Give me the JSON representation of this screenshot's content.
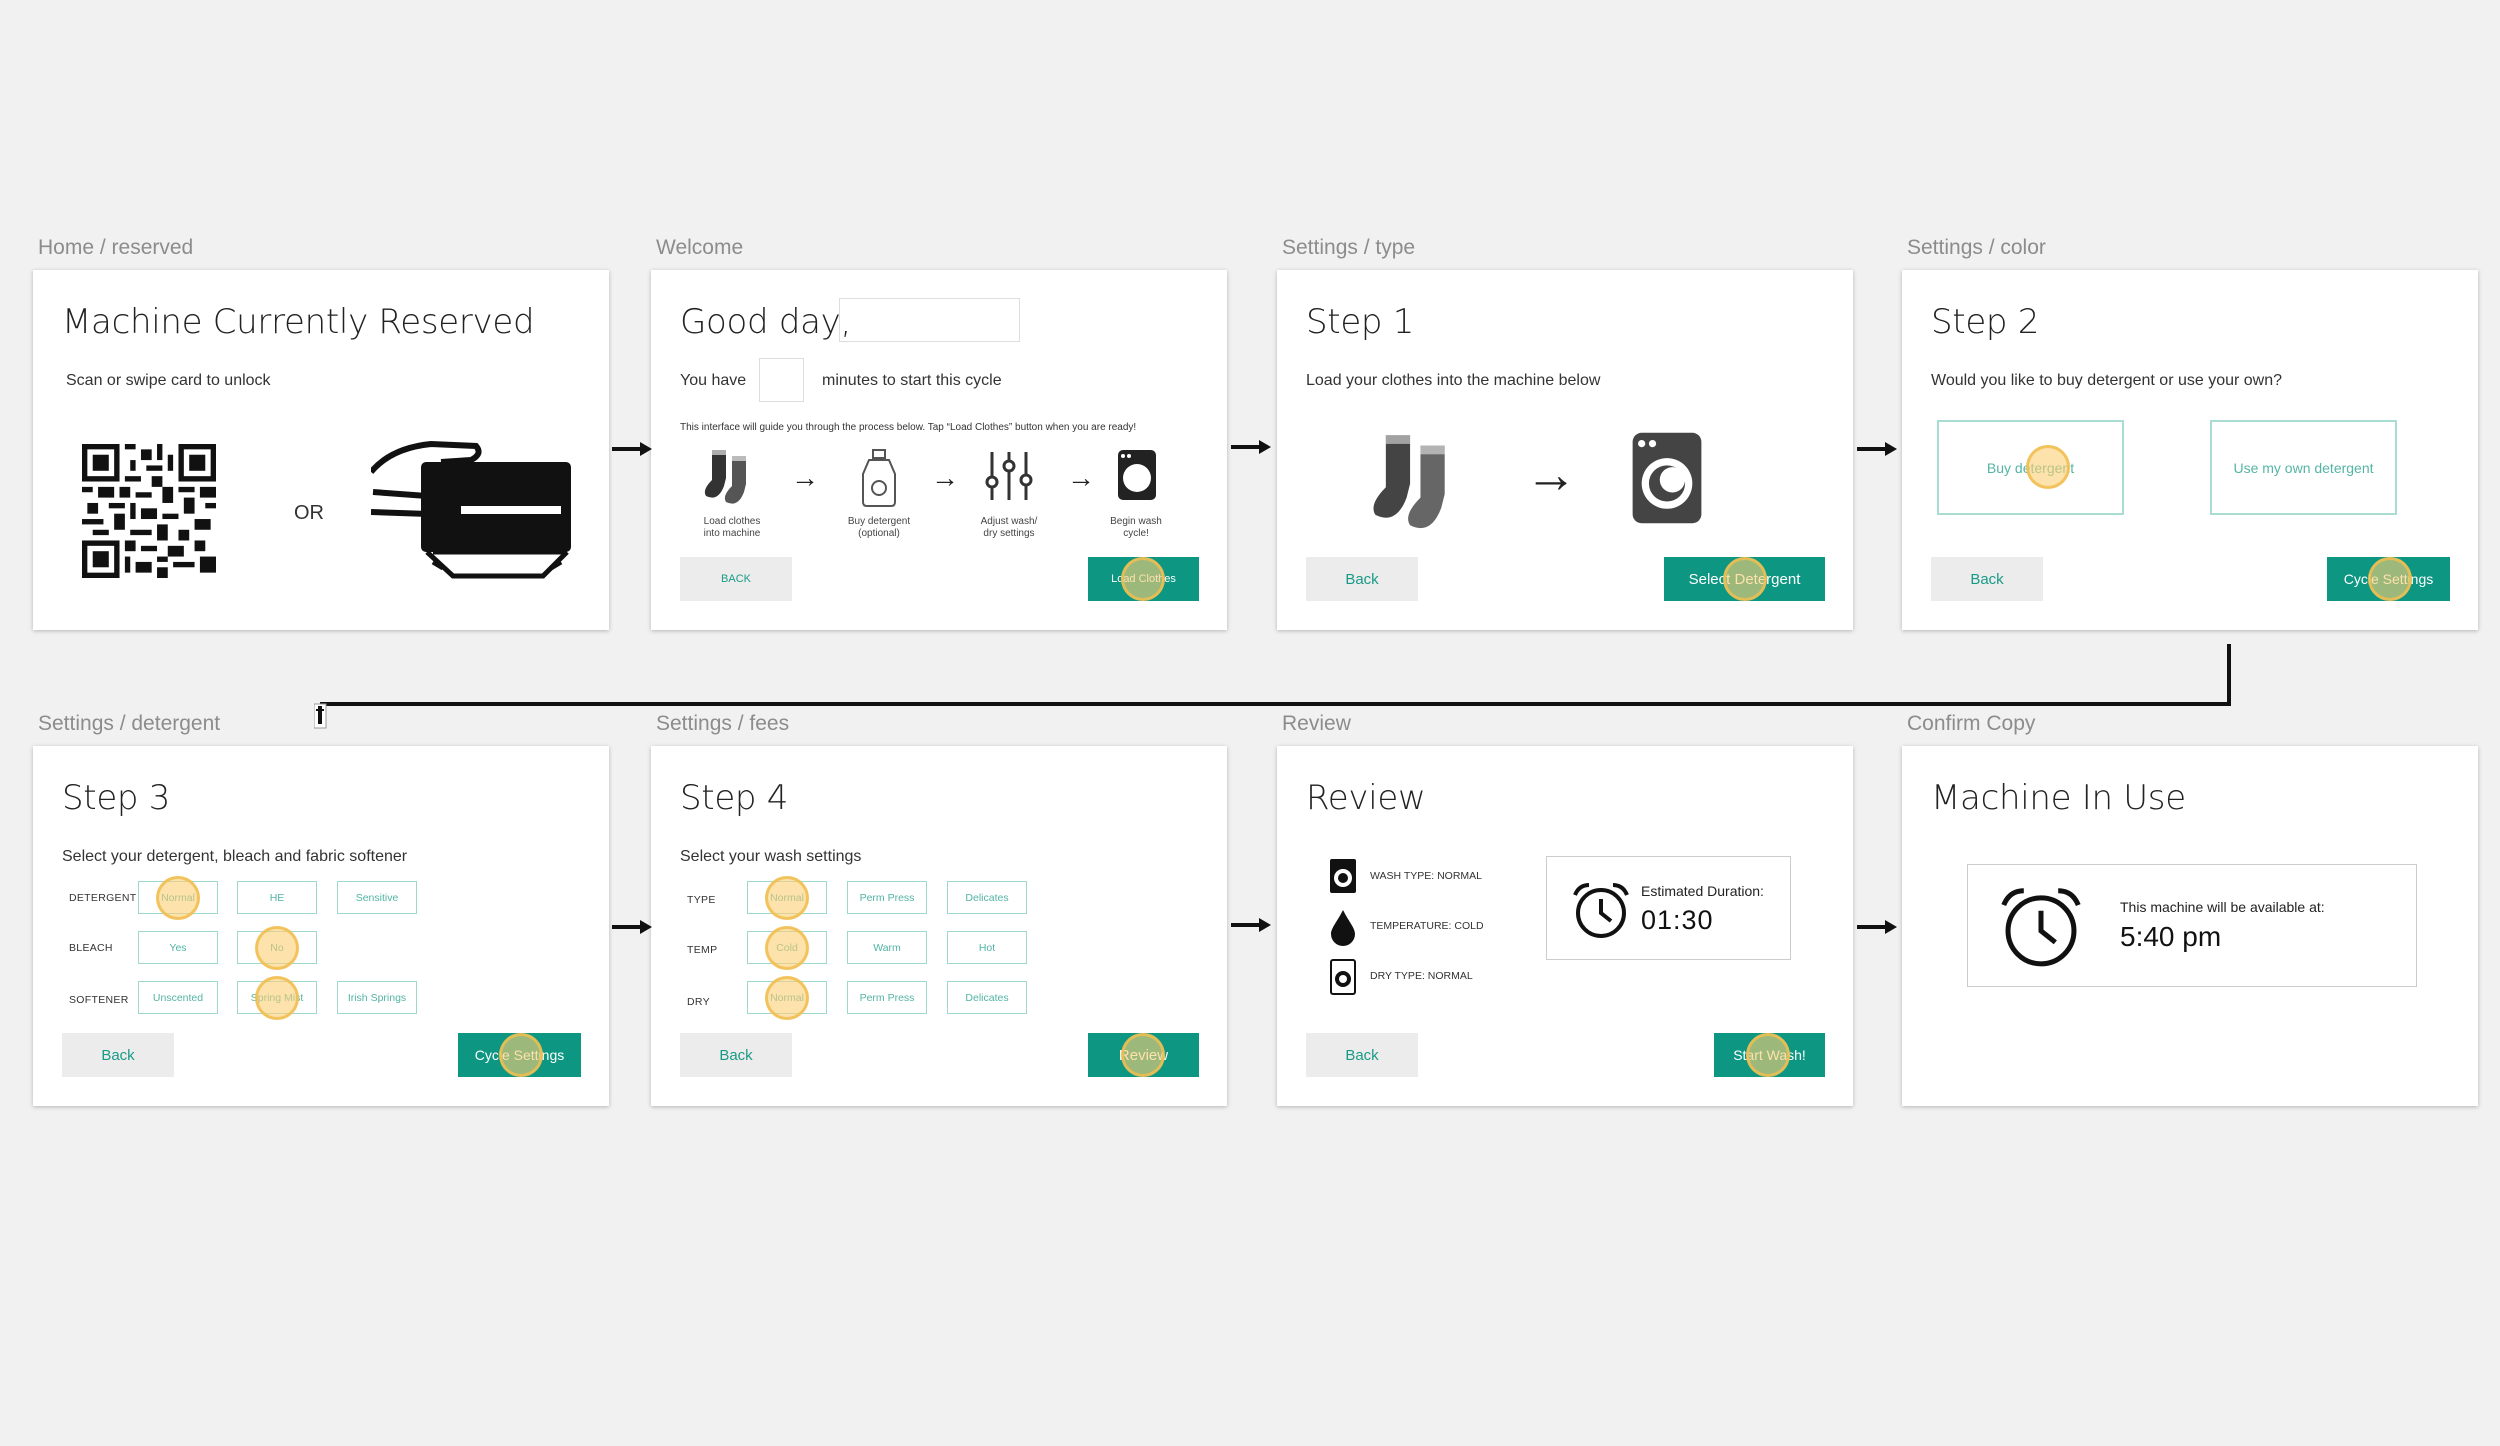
{
  "frames": [
    {
      "label": "Home / reserved",
      "title": "Machine Currently Reserved",
      "subtitle": "Scan or swipe card to unlock",
      "or_text": "OR",
      "icons": [
        "qr-code-icon",
        "card-swipe-icon"
      ]
    },
    {
      "label": "Welcome",
      "title": "Good day,",
      "you_have": "You have",
      "minutes_text": "minutes to start this cycle",
      "guide_text": "This interface will guide you through the process below. Tap “Load Clothes” button when you are ready!",
      "steps": [
        {
          "caption_1": "Load clothes",
          "caption_2": "into machine",
          "icon": "socks-icon"
        },
        {
          "caption_1": "Buy detergent",
          "caption_2": "(optional)",
          "icon": "detergent-bottle-icon"
        },
        {
          "caption_1": "Adjust wash/",
          "caption_2": "dry settings",
          "icon": "sliders-icon"
        },
        {
          "caption_1": "Begin wash",
          "caption_2": "cycle!",
          "icon": "washing-machine-icon"
        }
      ],
      "back_label": "BACK",
      "primary_label": "Load Clothes"
    },
    {
      "label": "Settings / type",
      "title": "Step 1",
      "subtitle": "Load your clothes into the machine below",
      "back_label": "Back",
      "primary_label": "Select Detergent"
    },
    {
      "label": "Settings / color",
      "title": "Step 2",
      "subtitle": "Would you like to buy detergent or use your own?",
      "option_1": "Buy detergent",
      "option_2": "Use my own detergent",
      "back_label": "Back",
      "primary_label": "Cycle Settings"
    },
    {
      "label": "Settings / detergent",
      "title": "Step 3",
      "subtitle": "Select your detergent, bleach and fabric softener",
      "rows": [
        {
          "label": "DETERGENT",
          "options": [
            "Normal",
            "HE",
            "Sensitive"
          ]
        },
        {
          "label": "BLEACH",
          "options": [
            "Yes",
            "No"
          ]
        },
        {
          "label": "SOFTENER",
          "options": [
            "Unscented",
            "Spring Mist",
            "Irish Springs"
          ]
        }
      ],
      "back_label": "Back",
      "primary_label": "Cycle Settings"
    },
    {
      "label": "Settings / fees",
      "title": "Step 4",
      "subtitle": "Select your wash settings",
      "rows": [
        {
          "label": "TYPE",
          "options": [
            "Normal",
            "Perm Press",
            "Delicates"
          ]
        },
        {
          "label": "TEMP",
          "options": [
            "Cold",
            "Warm",
            "Hot"
          ]
        },
        {
          "label": "DRY",
          "options": [
            "Normal",
            "Perm Press",
            "Delicates"
          ]
        }
      ],
      "back_label": "Back",
      "primary_label": "Review"
    },
    {
      "label": "Review",
      "title": "Review",
      "summary": [
        "WASH TYPE: NORMAL",
        "TEMPERATURE: COLD",
        "DRY TYPE: NORMAL"
      ],
      "duration_label": "Estimated Duration:",
      "duration_value": "01:30",
      "back_label": "Back",
      "primary_label": "Start Wash!"
    },
    {
      "label": "Confirm Copy",
      "title": "Machine In Use",
      "available_label": "This machine will be available at:",
      "available_time": "5:40 pm"
    }
  ],
  "colors": {
    "accent": "#0d9682",
    "highlight": "#fbce74",
    "background": "#f1f1f1"
  }
}
